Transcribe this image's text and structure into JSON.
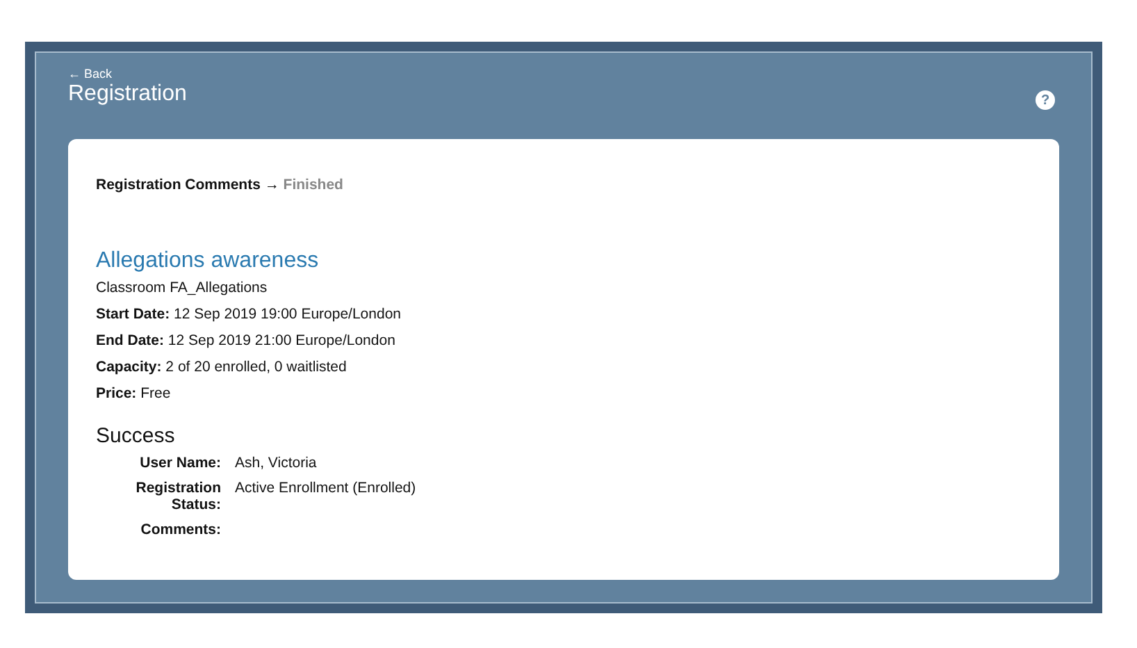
{
  "header": {
    "back": "← Back",
    "title": "Registration",
    "help": "?"
  },
  "breadcrumb": {
    "separator": "→",
    "steps": [
      {
        "label": "Registration Comments",
        "current": false
      },
      {
        "label": "Finished",
        "current": true
      }
    ]
  },
  "course": {
    "title": "Allegations awareness",
    "subtitle": "Classroom FA_Allegations",
    "details": [
      {
        "label": "Start Date:",
        "value": "12 Sep 2019 19:00 Europe/London"
      },
      {
        "label": "End Date:",
        "value": "12 Sep 2019 21:00 Europe/London"
      },
      {
        "label": "Capacity:",
        "value": "2 of 20 enrolled, 0 waitlisted"
      },
      {
        "label": "Price:",
        "value": "Free"
      }
    ]
  },
  "result": {
    "heading": "Success",
    "rows": [
      {
        "label": "User Name:",
        "value": "Ash, Victoria"
      },
      {
        "label": "Registration Status:",
        "value": "Active Enrollment (Enrolled)"
      },
      {
        "label": "Comments:"
      }
    ]
  }
}
